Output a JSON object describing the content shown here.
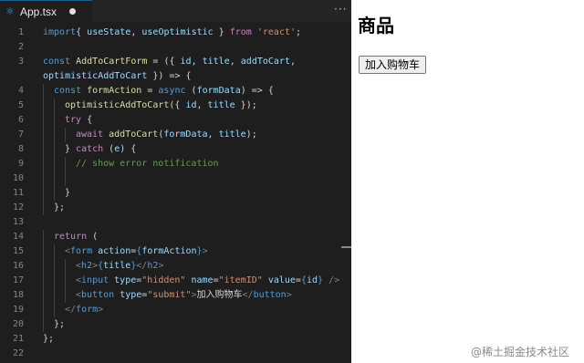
{
  "tab": {
    "icon": "react-icon",
    "label": "App.tsx",
    "more": "···"
  },
  "lines": [
    {
      "n": "1",
      "parts": [
        [
          "k",
          "import"
        ],
        [
          "",
          "{ "
        ],
        [
          "v",
          "useState"
        ],
        [
          "",
          ", "
        ],
        [
          "v",
          "useOptimistic"
        ],
        [
          "",
          " } "
        ],
        [
          "ck",
          "from"
        ],
        [
          "",
          " "
        ],
        [
          "s",
          "'react'"
        ],
        [
          "",
          ";"
        ]
      ]
    },
    {
      "n": "2",
      "parts": []
    },
    {
      "n": "3",
      "parts": [
        [
          "k",
          "const "
        ],
        [
          "fn",
          "AddToCartForm"
        ],
        [
          "",
          " = ({ "
        ],
        [
          "v",
          "id"
        ],
        [
          "",
          ", "
        ],
        [
          "v",
          "title"
        ],
        [
          "",
          ", "
        ],
        [
          "v",
          "addToCart"
        ],
        [
          "",
          ","
        ]
      ]
    },
    {
      "n": "",
      "parts": [
        [
          "v",
          "optimisticAddToCart"
        ],
        [
          "",
          " }) => {"
        ]
      ]
    },
    {
      "n": "4",
      "indent": 1,
      "parts": [
        [
          "k",
          "const "
        ],
        [
          "fn",
          "formAction"
        ],
        [
          "",
          " = "
        ],
        [
          "k",
          "async "
        ],
        [
          "",
          "("
        ],
        [
          "v",
          "formData"
        ],
        [
          "",
          ") => {"
        ]
      ]
    },
    {
      "n": "5",
      "indent": 2,
      "parts": [
        [
          "fn",
          "optimisticAddToCart"
        ],
        [
          "",
          "({ "
        ],
        [
          "v",
          "id"
        ],
        [
          "",
          ", "
        ],
        [
          "v",
          "title"
        ],
        [
          "",
          " });"
        ]
      ]
    },
    {
      "n": "6",
      "indent": 2,
      "parts": [
        [
          "ck",
          "try "
        ],
        [
          "",
          "{"
        ]
      ]
    },
    {
      "n": "7",
      "indent": 3,
      "parts": [
        [
          "ck",
          "await "
        ],
        [
          "fn",
          "addToCart"
        ],
        [
          "",
          "("
        ],
        [
          "v",
          "formData"
        ],
        [
          "",
          ", "
        ],
        [
          "v",
          "title"
        ],
        [
          "",
          ");"
        ]
      ]
    },
    {
      "n": "8",
      "indent": 2,
      "parts": [
        [
          "",
          "} "
        ],
        [
          "ck",
          "catch "
        ],
        [
          "",
          "("
        ],
        [
          "v",
          "e"
        ],
        [
          "",
          ") {"
        ]
      ]
    },
    {
      "n": "9",
      "indent": 3,
      "parts": [
        [
          "cm",
          "// show error notification"
        ]
      ]
    },
    {
      "n": "10",
      "indent": 3,
      "parts": []
    },
    {
      "n": "11",
      "indent": 2,
      "parts": [
        [
          "",
          "}"
        ]
      ]
    },
    {
      "n": "12",
      "indent": 1,
      "parts": [
        [
          "",
          "};"
        ]
      ]
    },
    {
      "n": "13",
      "parts": []
    },
    {
      "n": "14",
      "indent": 1,
      "parts": [
        [
          "ck",
          "return "
        ],
        [
          "",
          "("
        ]
      ]
    },
    {
      "n": "15",
      "indent": 2,
      "parts": [
        [
          "br",
          "<"
        ],
        [
          "tg",
          "form "
        ],
        [
          "v",
          "action"
        ],
        [
          "",
          "="
        ],
        [
          "k",
          "{"
        ],
        [
          "v",
          "formAction"
        ],
        [
          "k",
          "}"
        ],
        [
          "br",
          ">"
        ]
      ]
    },
    {
      "n": "16",
      "indent": 3,
      "parts": [
        [
          "br",
          "<"
        ],
        [
          "tg",
          "h2"
        ],
        [
          "br",
          ">"
        ],
        [
          "k",
          "{"
        ],
        [
          "v",
          "title"
        ],
        [
          "k",
          "}"
        ],
        [
          "br",
          "</"
        ],
        [
          "tg",
          "h2"
        ],
        [
          "br",
          ">"
        ]
      ]
    },
    {
      "n": "17",
      "indent": 3,
      "parts": [
        [
          "br",
          "<"
        ],
        [
          "tg",
          "input "
        ],
        [
          "v",
          "type"
        ],
        [
          "",
          "="
        ],
        [
          "s",
          "\"hidden\""
        ],
        [
          "",
          " "
        ],
        [
          "v",
          "name"
        ],
        [
          "",
          "="
        ],
        [
          "s",
          "\"itemID\""
        ],
        [
          "",
          " "
        ],
        [
          "v",
          "value"
        ],
        [
          "",
          "="
        ],
        [
          "k",
          "{"
        ],
        [
          "v",
          "id"
        ],
        [
          "k",
          "}"
        ],
        [
          "",
          " "
        ],
        [
          "br",
          "/>"
        ]
      ]
    },
    {
      "n": "18",
      "indent": 3,
      "parts": [
        [
          "br",
          "<"
        ],
        [
          "tg",
          "button "
        ],
        [
          "v",
          "type"
        ],
        [
          "",
          "="
        ],
        [
          "s",
          "\"submit\""
        ],
        [
          "br",
          ">"
        ],
        [
          "",
          "加入购物车"
        ],
        [
          "br",
          "</"
        ],
        [
          "tg",
          "button"
        ],
        [
          "br",
          ">"
        ]
      ]
    },
    {
      "n": "19",
      "indent": 2,
      "parts": [
        [
          "br",
          "</"
        ],
        [
          "tg",
          "form"
        ],
        [
          "br",
          ">"
        ]
      ]
    },
    {
      "n": "20",
      "indent": 1,
      "parts": [
        [
          "",
          "};"
        ]
      ]
    },
    {
      "n": "21",
      "parts": [
        [
          "",
          "};"
        ]
      ]
    },
    {
      "n": "22",
      "parts": []
    }
  ],
  "preview": {
    "title": "商品",
    "button": "加入购物车"
  },
  "watermark": "@稀土掘金技术社区"
}
